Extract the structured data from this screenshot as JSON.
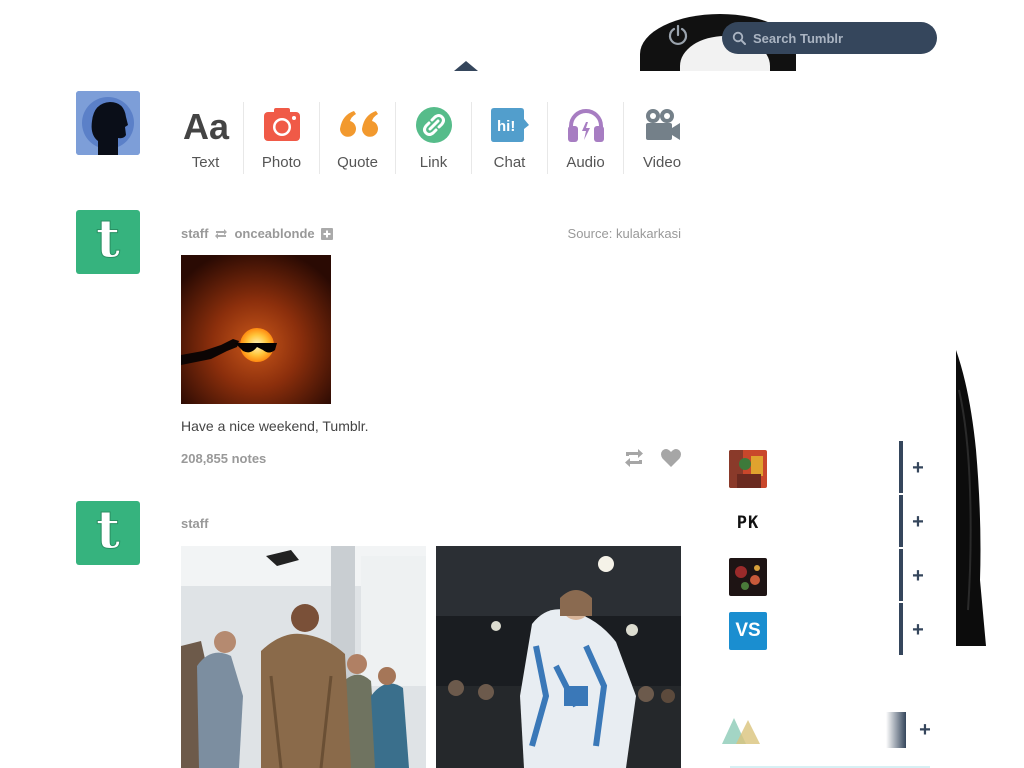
{
  "header": {
    "search_placeholder": "Search Tumblr",
    "brand_color": "#35465c"
  },
  "post_types": [
    {
      "label": "Text",
      "icon": "text-icon",
      "color": "#444444"
    },
    {
      "label": "Photo",
      "icon": "camera-icon",
      "color": "#f05a47"
    },
    {
      "label": "Quote",
      "icon": "quote-icon",
      "color": "#f2992e"
    },
    {
      "label": "Link",
      "icon": "link-icon",
      "color": "#56bc8a"
    },
    {
      "label": "Chat",
      "icon": "chat-icon",
      "color": "#529ecc"
    },
    {
      "label": "Audio",
      "icon": "headphones-icon",
      "color": "#a77dc2"
    },
    {
      "label": "Video",
      "icon": "video-camera-icon",
      "color": "#748089"
    }
  ],
  "posts": [
    {
      "author": "staff",
      "reblogged_from": "onceablonde",
      "source_label": "Source:",
      "source": "kulakarkasi",
      "caption": "Have a nice weekend, Tumblr.",
      "notes": "208,855 notes"
    },
    {
      "author": "staff"
    }
  ],
  "sidebar": {
    "recommended": [
      {
        "thumb": "colorful-photo-thumb"
      },
      {
        "thumb": "pk-logo-thumb",
        "thumb_text": "PK"
      },
      {
        "thumb": "dark-floral-thumb"
      },
      {
        "thumb": "vs-logo-thumb",
        "thumb_text": "VS"
      },
      {
        "thumb": "triangles-thumb"
      }
    ],
    "follow_symbol": "+"
  }
}
